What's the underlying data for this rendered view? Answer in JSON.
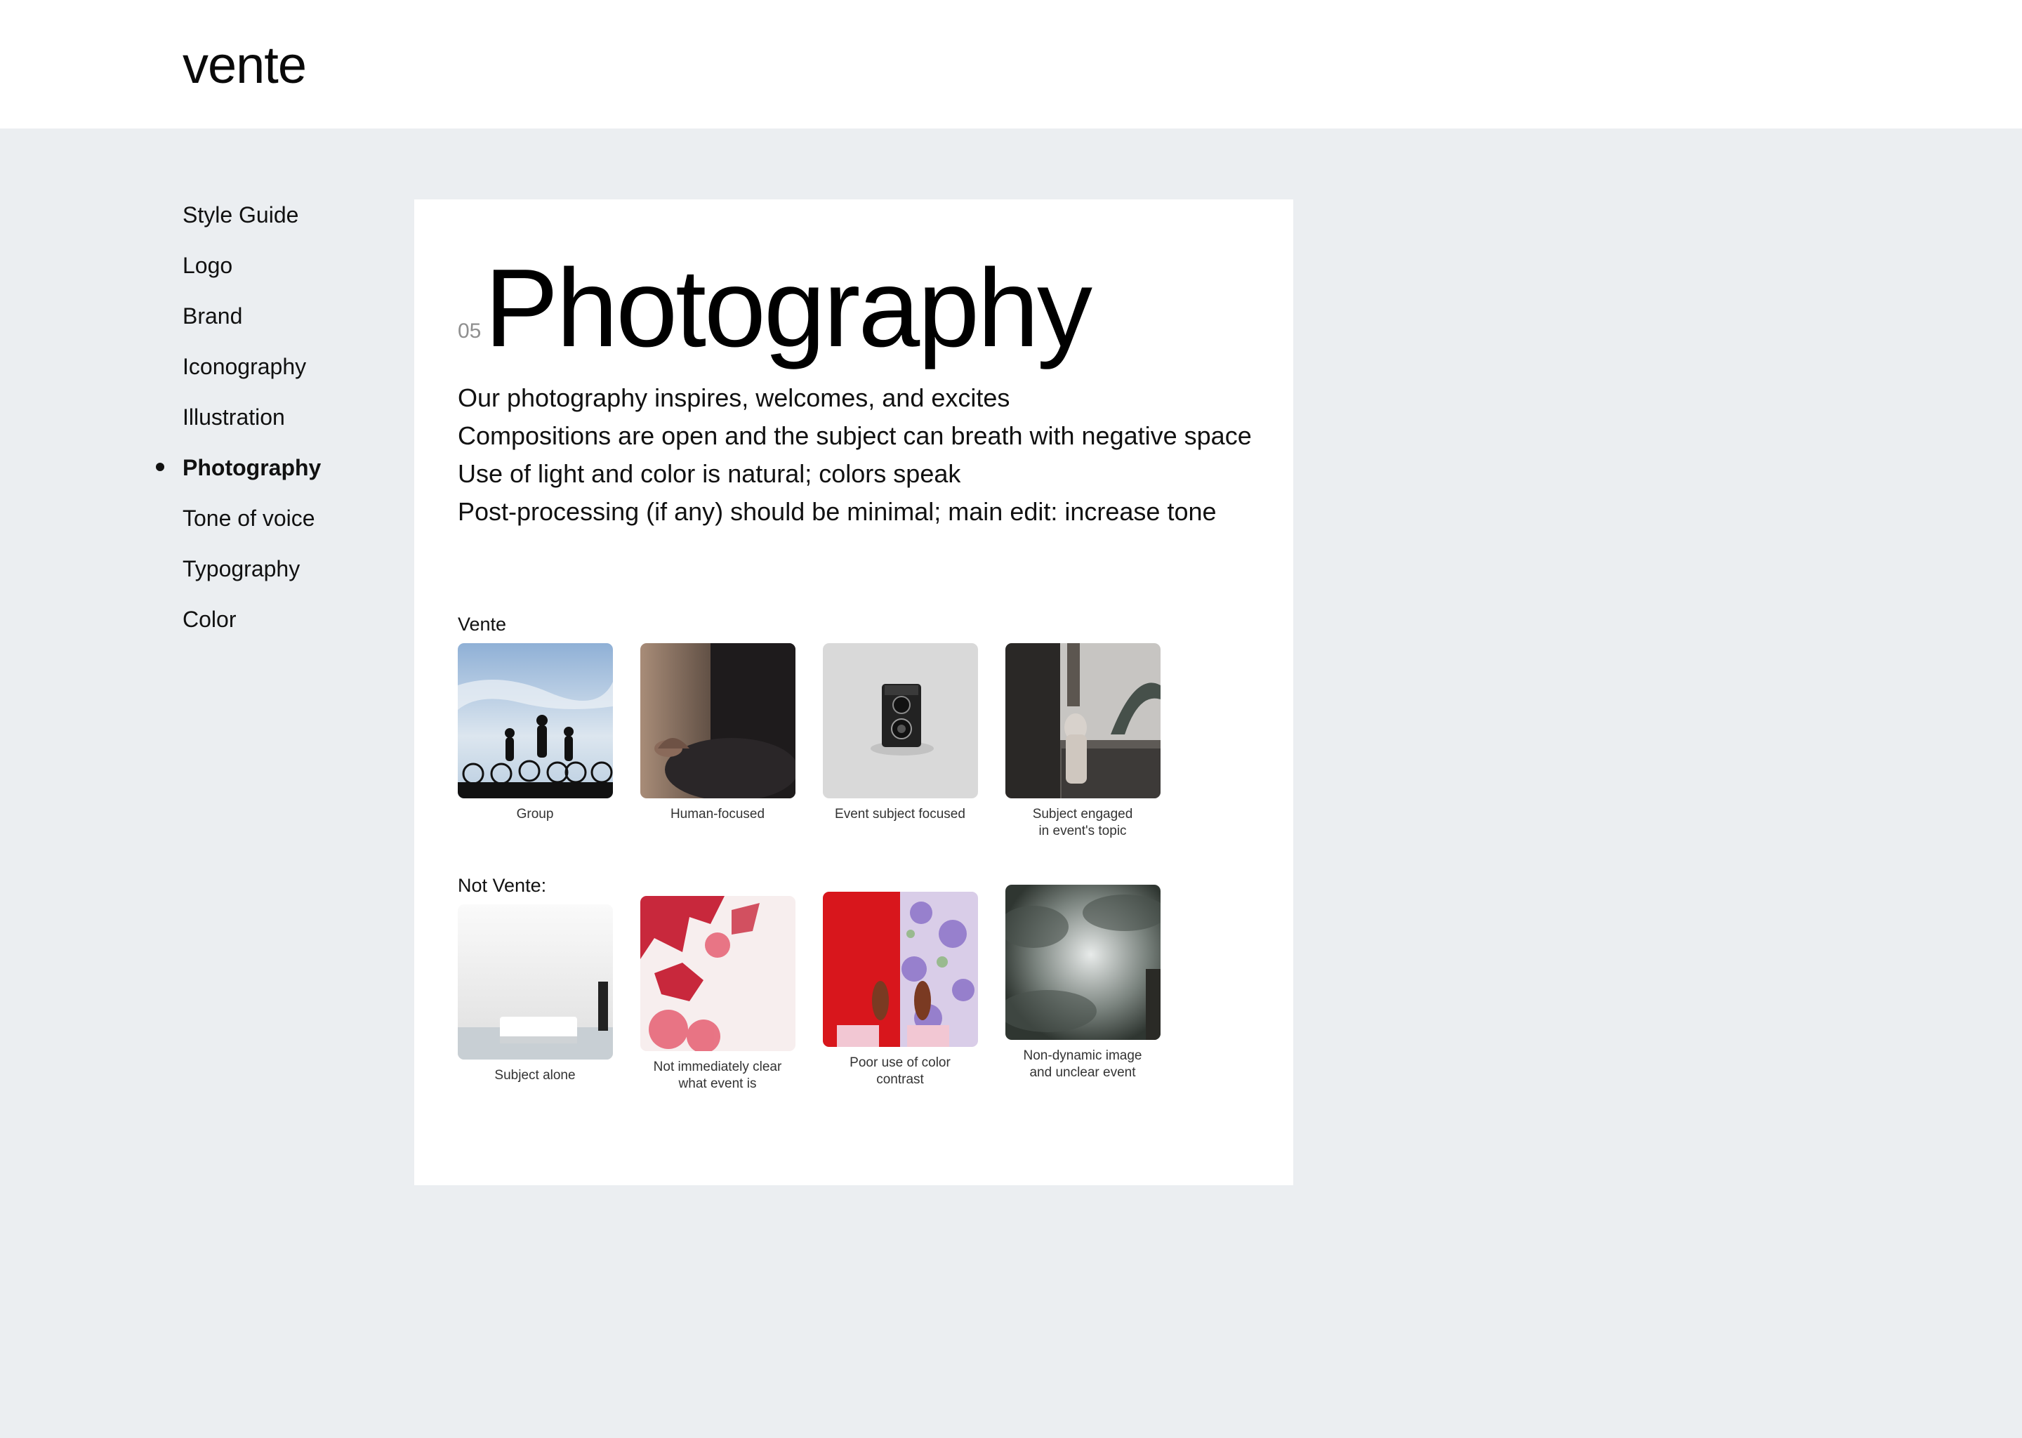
{
  "header": {
    "logo": "vente"
  },
  "sidebar": {
    "items": [
      {
        "label": "Style Guide"
      },
      {
        "label": "Logo"
      },
      {
        "label": "Brand"
      },
      {
        "label": "Iconography"
      },
      {
        "label": "Illustration"
      },
      {
        "label": "Photography",
        "active": true
      },
      {
        "label": "Tone of voice"
      },
      {
        "label": "Typography"
      },
      {
        "label": "Color"
      }
    ]
  },
  "main": {
    "section_number": "05",
    "title": "Photography",
    "intro": [
      "Our photography inspires, welcomes, and excites",
      "Compositions are open and the subject can breath with negative space",
      "Use of light and color is natural; colors speak",
      "Post-processing (if any) should be minimal; main edit: increase tone"
    ],
    "vente": {
      "label": "Vente",
      "photos": [
        {
          "icon": "cyclists-silhouette-photo",
          "caption": [
            "Group"
          ]
        },
        {
          "icon": "meditation-hands-photo",
          "caption": [
            "Human-focused"
          ]
        },
        {
          "icon": "vintage-camera-photo",
          "caption": [
            "Event subject focused"
          ]
        },
        {
          "icon": "london-photographer-photo",
          "caption": [
            "Subject engaged",
            "in event's topic"
          ]
        }
      ]
    },
    "not_vente": {
      "label": "Not Vente:",
      "photos": [
        {
          "icon": "white-seating-photo",
          "caption": [
            "Subject alone"
          ]
        },
        {
          "icon": "red-leaves-photo",
          "caption": [
            "Not immediately clear",
            "what event is"
          ]
        },
        {
          "icon": "red-floor-shoes-photo",
          "caption": [
            "Poor use of color",
            "contrast"
          ]
        },
        {
          "icon": "cloudy-sky-photo",
          "caption": [
            "Non-dynamic image",
            "and unclear event"
          ]
        }
      ]
    }
  }
}
